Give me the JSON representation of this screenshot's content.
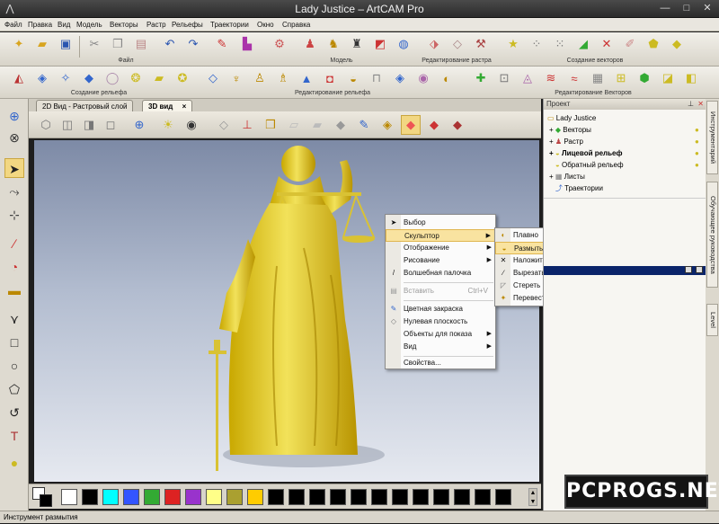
{
  "window": {
    "title": "Lady Justice – ArtCAM Pro",
    "minimize": "—",
    "maximize": "□",
    "close": "✕"
  },
  "menu": [
    "Файл",
    "Правка",
    "Вид",
    "Модель",
    "Векторы",
    "Растр",
    "Рельефы",
    "Траектории",
    "Окно",
    "Справка"
  ],
  "toolbar_groups": {
    "file": "Файл",
    "model": "Модель",
    "raster_edit": "Редактирование растра",
    "vector_create": "Создание векторов",
    "relief_create": "Создание рельефа",
    "relief_edit": "Редактирование рельефа",
    "vector_edit": "Редактирование Векторов"
  },
  "tabs": [
    {
      "label": "2D Вид - Растровый слой",
      "close": "×"
    },
    {
      "label": "3D вид",
      "close": "×"
    }
  ],
  "project_panel": {
    "header": "Проект",
    "items": [
      {
        "label": "Lady Justice",
        "icon": "folder-icon"
      },
      {
        "label": "Векторы",
        "icon": "vector-icon"
      },
      {
        "label": "Растр",
        "icon": "raster-icon"
      },
      {
        "label": "Лицевой рельеф",
        "icon": "relief-icon",
        "bold": true
      },
      {
        "label": "Обратный рельеф",
        "icon": "relief-icon"
      },
      {
        "label": "Листы",
        "icon": "sheets-icon"
      },
      {
        "label": "Траектории",
        "icon": "toolpath-icon"
      }
    ]
  },
  "side_tabs": [
    "Инструментарий",
    "Обучающее руководства",
    "Level"
  ],
  "context_menu": {
    "items": [
      {
        "label": "Выбор",
        "icon": "cursor-icon"
      },
      {
        "label": "Скульптор",
        "submenu": true,
        "highlighted": true
      },
      {
        "label": "Отображение",
        "submenu": true
      },
      {
        "label": "Рисование",
        "submenu": true
      },
      {
        "label": "Волшебная палочка",
        "icon": "wand-icon"
      },
      {
        "label": "Вставить",
        "shortcut": "Ctrl+V",
        "disabled": true,
        "icon": "paste-icon"
      },
      {
        "label": "Цветная закраска",
        "icon": "paint-icon"
      },
      {
        "label": "Нулевая плоскость",
        "icon": "plane-icon"
      },
      {
        "label": "Объекты для показа",
        "submenu": true
      },
      {
        "label": "Вид",
        "submenu": true
      },
      {
        "label": "Свойства..."
      }
    ],
    "sculpt_submenu": [
      {
        "label": "Плавно",
        "icon": "smooth-icon"
      },
      {
        "label": "Размыть",
        "icon": "blur-icon",
        "highlighted": true
      },
      {
        "label": "Наложить",
        "icon": "deposit-icon"
      },
      {
        "label": "Вырезать",
        "icon": "carve-icon"
      },
      {
        "label": "Стереть",
        "icon": "erase-icon"
      },
      {
        "label": "Перевести",
        "icon": "transfer-icon"
      }
    ]
  },
  "palette": {
    "swatches": [
      "#ffffff",
      "#000000",
      "#00ffff",
      "#3355ff",
      "#33aa33",
      "#dd2222",
      "#9933cc",
      "#ffff88",
      "#aaa030",
      "#ffcc00",
      "#000000",
      "#000000",
      "#000000",
      "#000000",
      "#000000",
      "#000000",
      "#000000",
      "#000000",
      "#000000",
      "#000000",
      "#000000",
      "#000000"
    ]
  },
  "status": {
    "text": "Инструмент размытия"
  },
  "watermark": "PCPROGS.NET",
  "colors": {
    "model_gold": "#e6cf2a",
    "accent_blue": "#0a246a",
    "menu_highlight": "#f9e3a0"
  }
}
